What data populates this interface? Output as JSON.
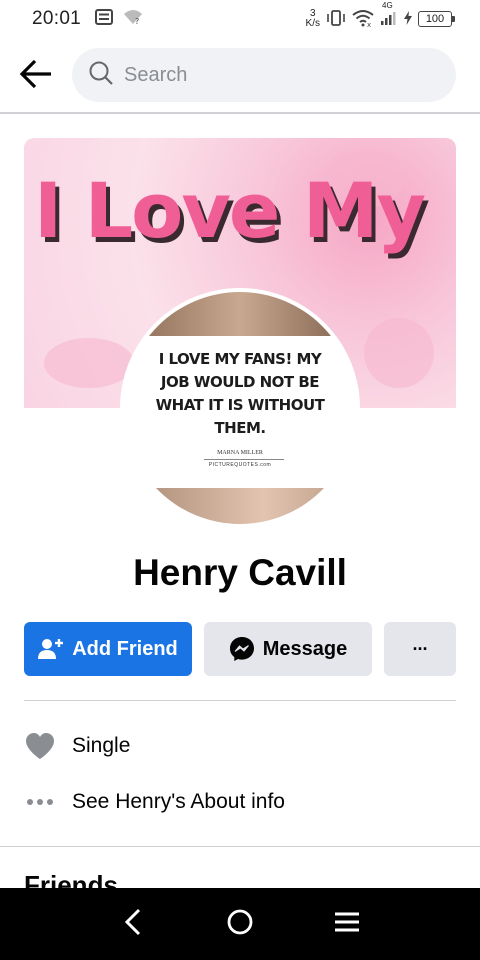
{
  "status_bar": {
    "time": "20:01",
    "net_speed_value": "3",
    "net_speed_unit": "K/s",
    "network_type": "4G",
    "battery": "100"
  },
  "search": {
    "placeholder": "Search"
  },
  "cover": {
    "text": "I Love My"
  },
  "profile_picture": {
    "quote": "I LOVE MY FANS! MY JOB WOULD NOT BE WHAT IT IS WITHOUT THEM.",
    "author": "MARNA MILLER",
    "source": "PICTUREQUOTES.com"
  },
  "profile": {
    "name": "Henry Cavill"
  },
  "actions": {
    "add_friend": "Add Friend",
    "message": "Message",
    "more": "···"
  },
  "details": {
    "relationship": "Single",
    "about": "See Henry's About info"
  },
  "sections": {
    "friends": "Friends"
  },
  "colors": {
    "primary": "#1b74e4",
    "secondary_button": "#e4e6eb",
    "search_bg": "#f0f2f5"
  }
}
